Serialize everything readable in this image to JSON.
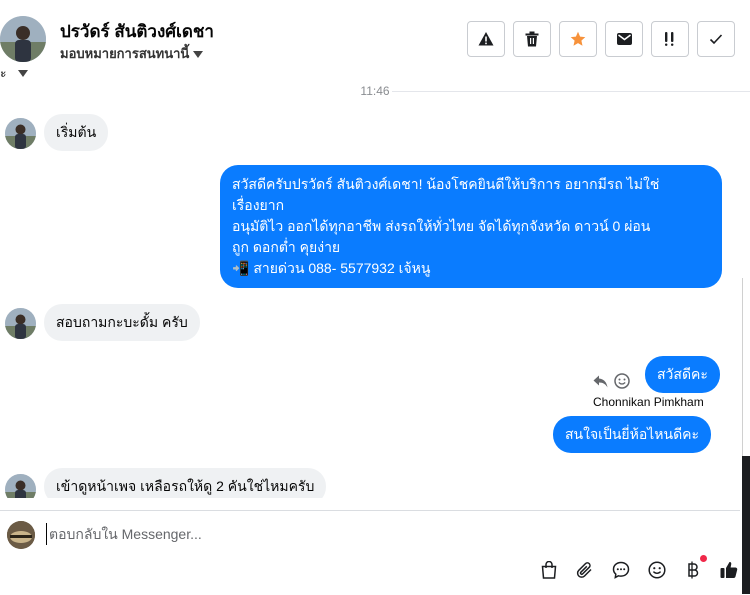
{
  "header": {
    "contact_name": "ปรวัดร์ สันติวงศ์เดชา",
    "assign_label": "มอบหมายการสนทนานี้",
    "status_label": "ะ",
    "actions": [
      {
        "icon": "warning-icon"
      },
      {
        "icon": "trash-icon"
      },
      {
        "icon": "star-icon"
      },
      {
        "icon": "envelope-icon"
      },
      {
        "icon": "follow-up-icon"
      },
      {
        "icon": "check-icon"
      }
    ]
  },
  "thread": {
    "timestamp": "11:46",
    "messages": [
      {
        "direction": "in",
        "text": "เริ่มต้น"
      },
      {
        "direction": "out",
        "lines": [
          "สวัสดีครับปรวัดร์ สันติวงศ์เดชา! น้องโชคยินดีให้บริการ อยากมีรถ ไม่ใช่",
          "เรื่องยาก",
          "อนุมัติไว ออกได้ทุกอาชีพ ส่งรถให้ทั่วไทย จัดได้ทุกจังหวัด ดาวน์ 0  ผ่อน",
          "ถูก ดอกต่ำ คุยง่าย",
          "📲 สายด่วน 088- 5577932 เจ้หนู"
        ]
      },
      {
        "direction": "in",
        "text": "สอบถามกะบะดั้ม ครับ"
      },
      {
        "direction": "out",
        "text": "สวัสดีคะ"
      },
      {
        "direction": "out",
        "text": "สนใจเป็นยี่ห้อไหนดีคะ",
        "sender": "Chonnikan Pimkham"
      },
      {
        "direction": "in",
        "text": "เข้าดูหน้าเพจ เหลือรถให้ดู  2 คันใช่ไหมครับ"
      }
    ]
  },
  "composer": {
    "placeholder": "ตอบกลับใน Messenger...",
    "value": "",
    "tools": [
      "shopping-bag-icon",
      "paperclip-icon",
      "saved-reply-icon",
      "emoji-icon",
      "baht-payment-icon",
      "thumbs-up-icon"
    ]
  },
  "colors": {
    "outgoing": "#0a7cff",
    "incoming": "#eff1f3",
    "star": "#f7923b",
    "notification_dot": "#f02849"
  }
}
